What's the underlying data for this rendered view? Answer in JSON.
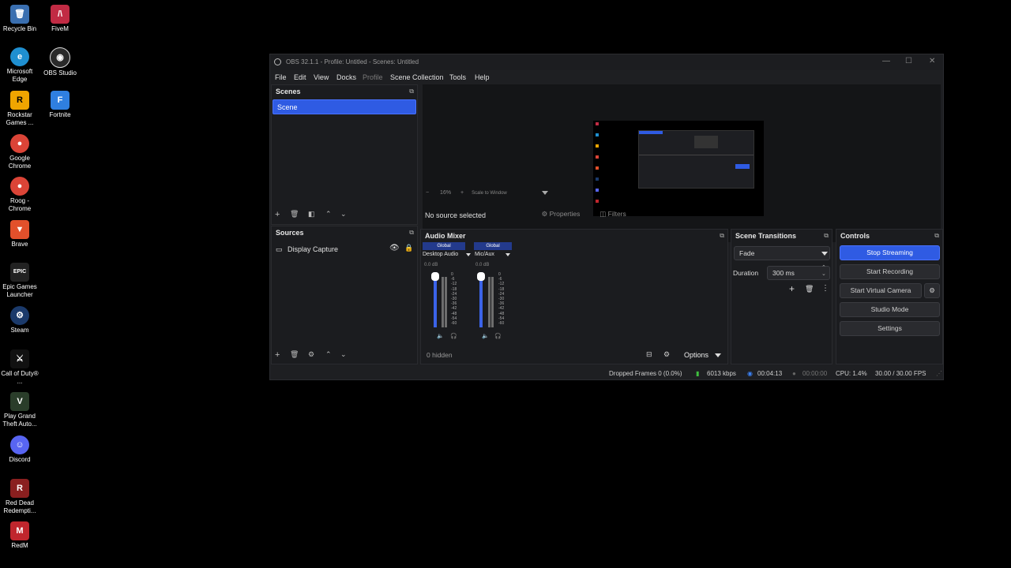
{
  "desktop": {
    "icons": [
      {
        "label": "Recycle Bin",
        "icon": "recycle-bin-icon",
        "color": "#3a6fb0"
      },
      {
        "label": "FiveM",
        "icon": "fivem-icon",
        "color": "#c12b44"
      },
      {
        "label": "Microsoft Edge",
        "icon": "edge-icon",
        "color": "#1f8fd0"
      },
      {
        "label": "OBS Studio",
        "icon": "obs-icon",
        "color": "#2a2a2a"
      },
      {
        "label": "Rockstar Games ...",
        "icon": "rockstar-icon",
        "color": "#f0a500"
      },
      {
        "label": "Fortnite",
        "icon": "fortnite-icon",
        "color": "#2f7fe0"
      },
      {
        "label": "Google Chrome",
        "icon": "chrome-icon",
        "color": "#db4437"
      },
      {
        "label": "Roog - Chrome",
        "icon": "chrome-profile-icon",
        "color": "#db4437"
      },
      {
        "label": "Brave",
        "icon": "brave-icon",
        "color": "#e2502b"
      },
      {
        "label": "Epic Games Launcher",
        "icon": "epic-games-icon",
        "color": "#222"
      },
      {
        "label": "Steam",
        "icon": "steam-icon",
        "color": "#1b3a6b"
      },
      {
        "label": "Call of Duty® ...",
        "icon": "call-of-duty-icon",
        "color": "#111"
      },
      {
        "label": "Play Grand Theft Auto...",
        "icon": "gta-icon",
        "color": "#2a3d2a"
      },
      {
        "label": "Discord",
        "icon": "discord-icon",
        "color": "#5865f2"
      },
      {
        "label": "Red Dead Redempti...",
        "icon": "red-dead-icon",
        "color": "#8a1f1f"
      },
      {
        "label": "RedM",
        "icon": "redm-icon",
        "color": "#c0262d"
      }
    ]
  },
  "window": {
    "title": "OBS 32.1.1 - Profile: Untitled - Scenes: Untitled",
    "menu": [
      "File",
      "Edit",
      "View",
      "Docks",
      "Profile",
      "Scene Collection",
      "Tools",
      "Help"
    ]
  },
  "scenes": {
    "title": "Scenes",
    "items": [
      "Scene"
    ]
  },
  "preview": {
    "zoom": "16%",
    "zoom_mode": "Scale to Window",
    "no_source": "No source selected",
    "properties": "Properties",
    "filters": "Filters"
  },
  "sources": {
    "title": "Sources",
    "items": [
      "Display Capture"
    ]
  },
  "audio_mixer": {
    "title": "Audio Mixer",
    "channels": [
      {
        "tag": "Global",
        "name": "Desktop Audio",
        "db": "0.0 dB"
      },
      {
        "tag": "Global",
        "name": "Mic/Aux",
        "db": "0.0 dB"
      }
    ],
    "scale": [
      "0",
      "-6",
      "-12",
      "-18",
      "-24",
      "-30",
      "-36",
      "-42",
      "-48",
      "-54",
      "-60"
    ],
    "hidden": "0 hidden",
    "options": "Options"
  },
  "transitions": {
    "title": "Scene Transitions",
    "selected": "Fade",
    "duration_label": "Duration",
    "duration_value": "300 ms"
  },
  "controls": {
    "title": "Controls",
    "stop_streaming": "Stop Streaming",
    "start_recording": "Start Recording",
    "start_virtual_camera": "Start Virtual Camera",
    "studio_mode": "Studio Mode",
    "settings": "Settings"
  },
  "status": {
    "dropped_frames": "Dropped Frames 0 (0.0%)",
    "bitrate": "6013 kbps",
    "stream_time": "00:04:13",
    "record_time": "00:00:00",
    "cpu": "CPU: 1.4%",
    "fps": "30.00 / 30.00 FPS"
  },
  "colors": {
    "accent": "#2f5be3",
    "bitrate_green": "#3fbf3f",
    "live_blue": "#3b82f6"
  }
}
